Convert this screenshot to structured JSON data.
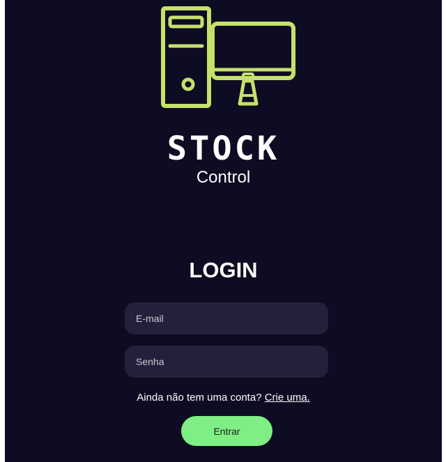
{
  "brand": {
    "icon": "computer-icon",
    "name": "STOCK",
    "subtitle": "Control",
    "accent_color": "#c5e16b"
  },
  "login": {
    "title": "LOGIN",
    "email_placeholder": "E-mail",
    "email_value": "",
    "password_placeholder": "Senha",
    "password_value": "",
    "signup_prompt": "Ainda não tem uma conta?",
    "signup_link": "Crie uma.",
    "submit_label": "Entrar",
    "submit_color": "#7fef85"
  },
  "colors": {
    "background": "#0e0c22",
    "field_background": "#22203a"
  }
}
